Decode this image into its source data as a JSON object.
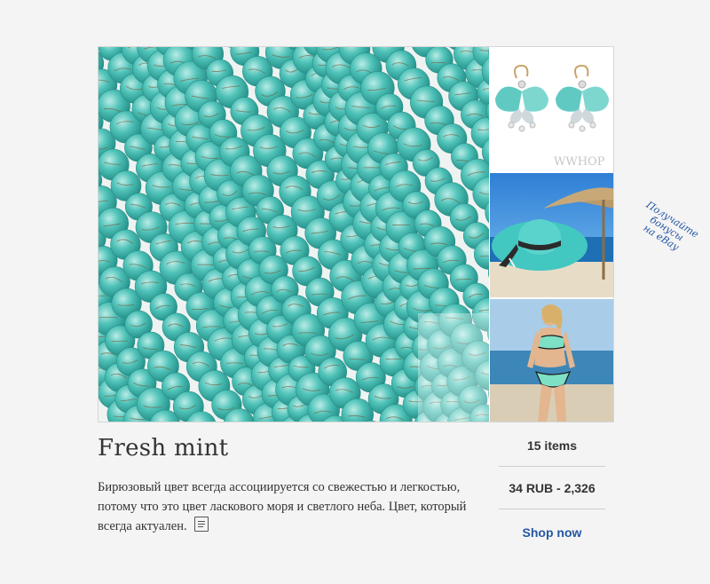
{
  "card": {
    "title": "Fresh mint",
    "description": "Бирюзовый цвет всегда ассоциируется со свежестью и легкостью, потому что это цвет ласкового моря и светлого неба. Цвет, который всегда актуален.",
    "items_count": "15 items",
    "price_range": "34 RUB - 2,326",
    "shop_link": "Shop now"
  },
  "images": {
    "main": "turquoise-beads-photo",
    "thumb_1": "butterfly-earrings-photo",
    "thumb_1_watermark": "WWHOP",
    "thumb_2": "turquoise-sun-hat-photo",
    "thumb_3": "mint-bikini-photo"
  },
  "promo": {
    "line1": "Получайте",
    "line2": "бонусы",
    "line3": "на eBay"
  },
  "colors": {
    "turquoise": "#3fb8b0",
    "link": "#2457a5",
    "text": "#333333"
  }
}
